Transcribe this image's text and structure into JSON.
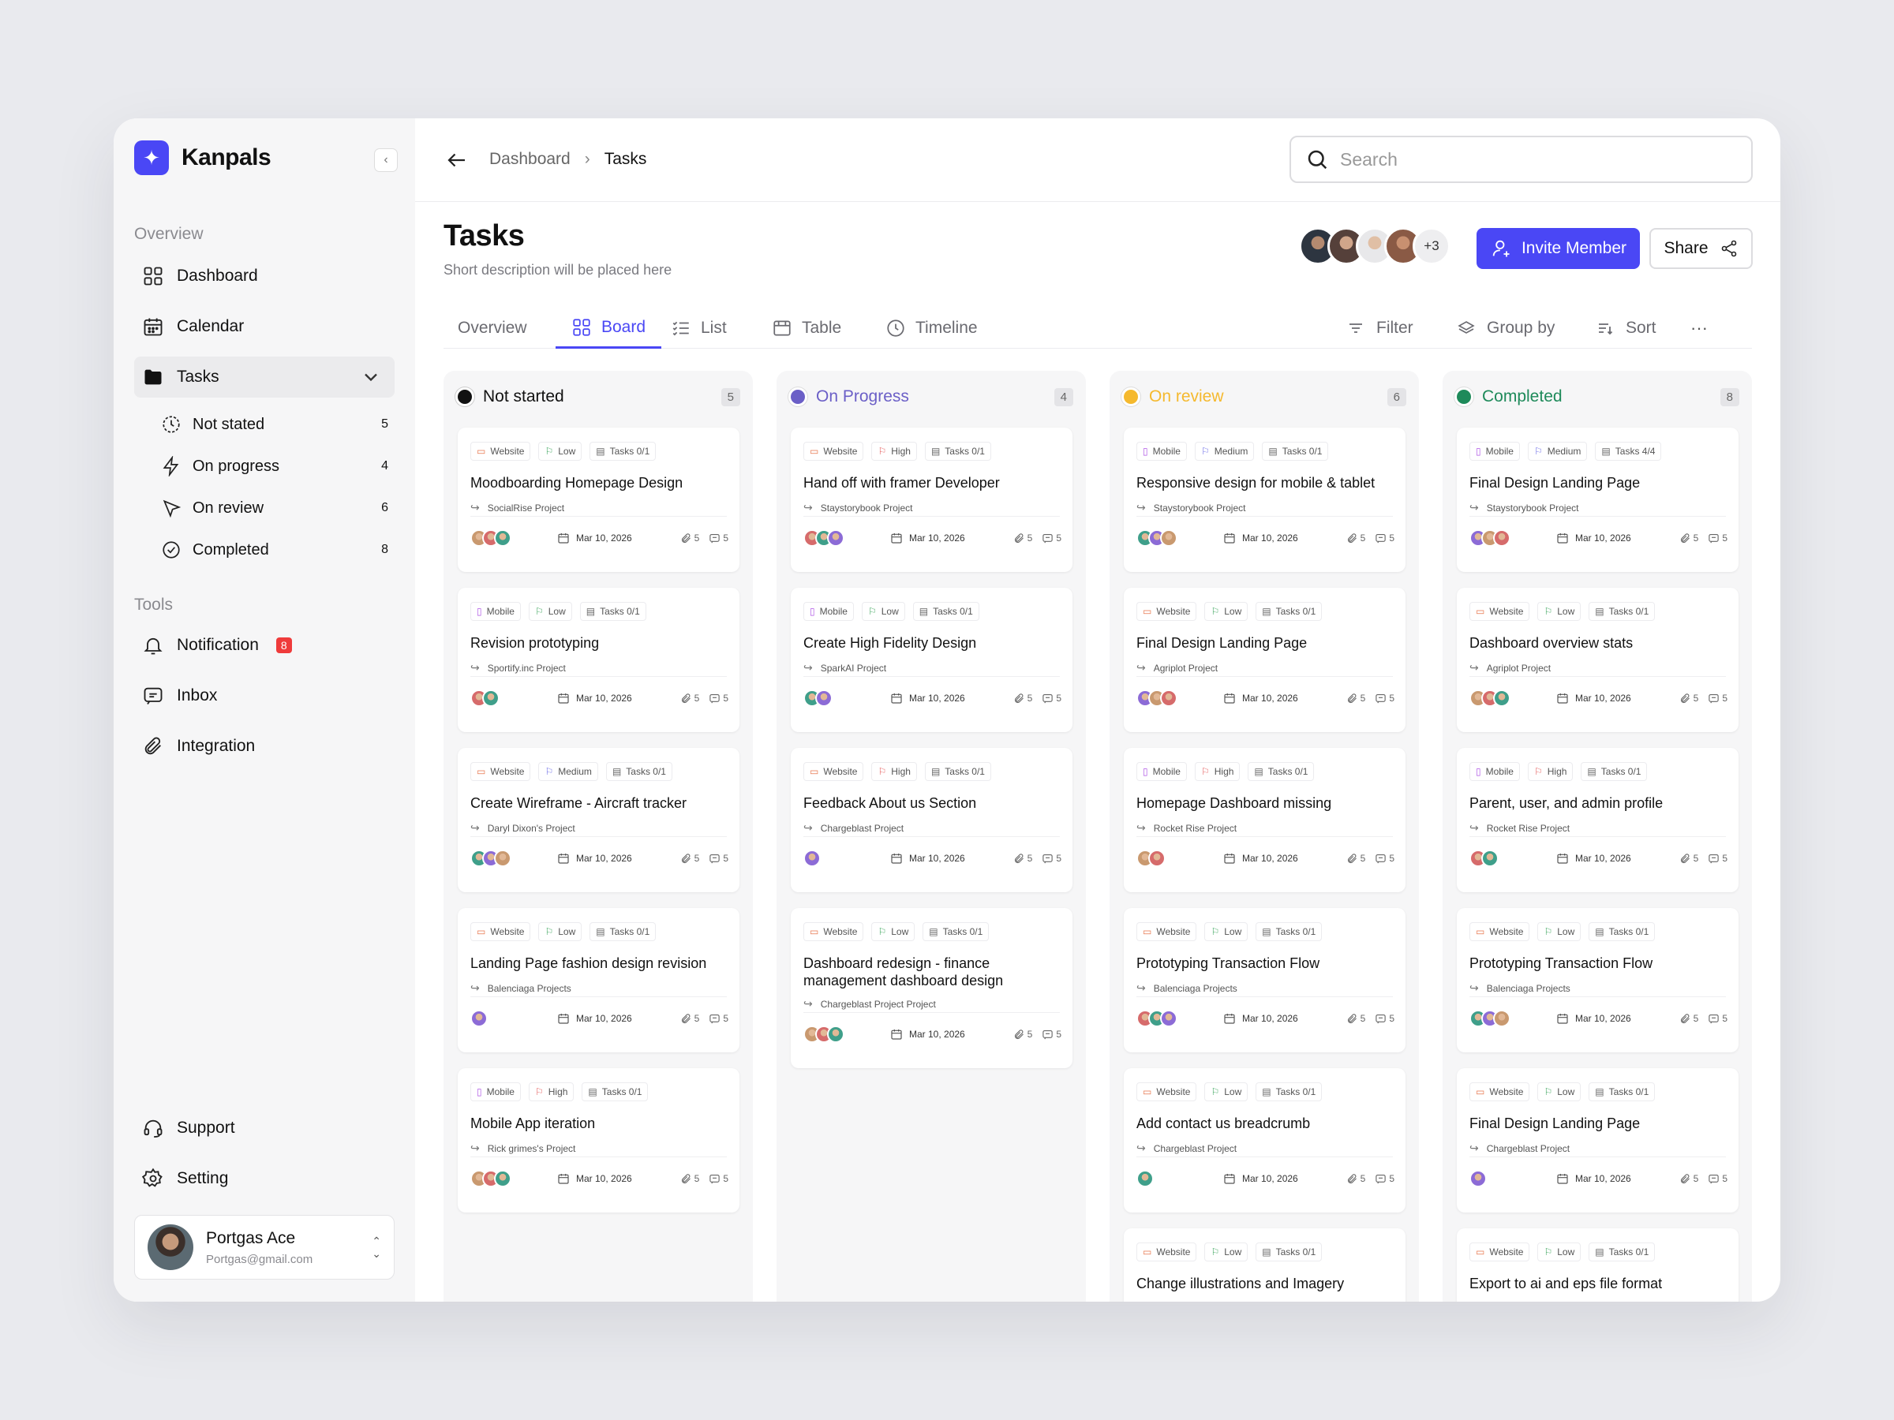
{
  "app": {
    "name": "Kanpals"
  },
  "sidebar": {
    "overview_label": "Overview",
    "tools_label": "Tools",
    "nav": {
      "dashboard": "Dashboard",
      "calendar": "Calendar",
      "tasks": "Tasks",
      "notification": "Notification",
      "notification_badge": "8",
      "inbox": "Inbox",
      "integration": "Integration",
      "support": "Support",
      "setting": "Setting"
    },
    "sub": [
      {
        "label": "Not stated",
        "count": "5"
      },
      {
        "label": "On progress",
        "count": "4"
      },
      {
        "label": "On review",
        "count": "6"
      },
      {
        "label": "Completed",
        "count": "8"
      }
    ],
    "profile": {
      "name": "Portgas Ace",
      "email": "Portgas@gmail.com"
    }
  },
  "topbar": {
    "crumb1": "Dashboard",
    "crumb2": "Tasks",
    "search_placeholder": "Search"
  },
  "header": {
    "title": "Tasks",
    "description": "Short description will be placed here",
    "more_members": "+3",
    "invite": "Invite Member",
    "share": "Share"
  },
  "tabs": [
    "Overview",
    "Board",
    "List",
    "Table",
    "Timeline"
  ],
  "tools": [
    "Filter",
    "Group by",
    "Sort"
  ],
  "colors": {
    "accent": "#4a47f5",
    "not_started": "#111111",
    "on_progress": "#6b5fc7",
    "on_review": "#f5b92e",
    "completed": "#1e8a5a"
  },
  "columns": [
    {
      "title": "Not started",
      "count": "5",
      "cards": [
        {
          "type": "Website",
          "priority": "Low",
          "tasks": "Tasks 0/1",
          "title": "Moodboarding Homepage Design",
          "project": "SocialRise Project",
          "members": 3,
          "date": "Mar 10, 2026",
          "attachments": "5",
          "comments": "5"
        },
        {
          "type": "Mobile",
          "priority": "Low",
          "tasks": "Tasks 0/1",
          "title": "Revision prototyping",
          "project": "Sportify.inc Project",
          "members": 2,
          "date": "Mar 10, 2026",
          "attachments": "5",
          "comments": "5"
        },
        {
          "type": "Website",
          "priority": "Medium",
          "tasks": "Tasks 0/1",
          "title": "Create Wireframe - Aircraft tracker",
          "project": "Daryl Dixon's Project",
          "members": 3,
          "date": "Mar 10, 2026",
          "attachments": "5",
          "comments": "5"
        },
        {
          "type": "Website",
          "priority": "Low",
          "tasks": "Tasks 0/1",
          "title": "Landing Page fashion design revision",
          "project": "Balenciaga Projects",
          "members": 1,
          "date": "Mar 10, 2026",
          "attachments": "5",
          "comments": "5"
        },
        {
          "type": "Mobile",
          "priority": "High",
          "tasks": "Tasks 0/1",
          "title": "Mobile App iteration",
          "project": "Rick grimes's Project",
          "members": 3,
          "date": "Mar 10, 2026",
          "attachments": "5",
          "comments": "5"
        }
      ]
    },
    {
      "title": "On Progress",
      "count": "4",
      "cards": [
        {
          "type": "Website",
          "priority": "High",
          "tasks": "Tasks 0/1",
          "title": "Hand off with framer Developer",
          "project": "Staystorybook Project",
          "members": 3,
          "date": "Mar 10, 2026",
          "attachments": "5",
          "comments": "5"
        },
        {
          "type": "Mobile",
          "priority": "Low",
          "tasks": "Tasks 0/1",
          "title": "Create High Fidelity Design",
          "project": "SparkAI Project",
          "members": 2,
          "date": "Mar 10, 2026",
          "attachments": "5",
          "comments": "5"
        },
        {
          "type": "Website",
          "priority": "High",
          "tasks": "Tasks 0/1",
          "title": "Feedback About us Section",
          "project": "Chargeblast  Project",
          "members": 1,
          "date": "Mar 10, 2026",
          "attachments": "5",
          "comments": "5"
        },
        {
          "type": "Website",
          "priority": "Low",
          "tasks": "Tasks 0/1",
          "title": "Dashboard redesign - finance management dashboard design",
          "project": "Chargeblast Project Project",
          "members": 3,
          "date": "Mar 10, 2026",
          "attachments": "5",
          "comments": "5"
        }
      ]
    },
    {
      "title": "On review",
      "count": "6",
      "cards": [
        {
          "type": "Mobile",
          "priority": "Medium",
          "tasks": "Tasks 0/1",
          "title": "Responsive design for mobile & tablet",
          "project": "Staystorybook Project",
          "members": 3,
          "date": "Mar 10, 2026",
          "attachments": "5",
          "comments": "5"
        },
        {
          "type": "Website",
          "priority": "Low",
          "tasks": "Tasks 0/1",
          "title": "Final Design Landing Page",
          "project": "Agriplot Project",
          "members": 3,
          "date": "Mar 10, 2026",
          "attachments": "5",
          "comments": "5"
        },
        {
          "type": "Mobile",
          "priority": "High",
          "tasks": "Tasks 0/1",
          "title": "Homepage Dashboard missing",
          "project": "Rocket Rise Project",
          "members": 2,
          "date": "Mar 10, 2026",
          "attachments": "5",
          "comments": "5"
        },
        {
          "type": "Website",
          "priority": "Low",
          "tasks": "Tasks 0/1",
          "title": "Prototyping Transaction Flow",
          "project": "Balenciaga Projects",
          "members": 3,
          "date": "Mar 10, 2026",
          "attachments": "5",
          "comments": "5"
        },
        {
          "type": "Website",
          "priority": "Low",
          "tasks": "Tasks 0/1",
          "title": "Add contact us breadcrumb",
          "project": "Chargeblast  Project",
          "members": 1,
          "date": "Mar 10, 2026",
          "attachments": "5",
          "comments": "5"
        },
        {
          "type": "Website",
          "priority": "Low",
          "tasks": "Tasks 0/1",
          "title": "Change illustrations and Imagery",
          "project": "",
          "members": 0,
          "date": "",
          "attachments": "",
          "comments": ""
        }
      ]
    },
    {
      "title": "Completed",
      "count": "8",
      "cards": [
        {
          "type": "Mobile",
          "priority": "Medium",
          "tasks": "Tasks 4/4",
          "title": "Final Design Landing Page",
          "project": "Staystorybook Project",
          "members": 3,
          "date": "Mar 10, 2026",
          "attachments": "5",
          "comments": "5"
        },
        {
          "type": "Website",
          "priority": "Low",
          "tasks": "Tasks 0/1",
          "title": "Dashboard overview stats",
          "project": "Agriplot Project",
          "members": 3,
          "date": "Mar 10, 2026",
          "attachments": "5",
          "comments": "5"
        },
        {
          "type": "Mobile",
          "priority": "High",
          "tasks": "Tasks 0/1",
          "title": "Parent, user, and admin profile",
          "project": "Rocket Rise Project",
          "members": 2,
          "date": "Mar 10, 2026",
          "attachments": "5",
          "comments": "5"
        },
        {
          "type": "Website",
          "priority": "Low",
          "tasks": "Tasks 0/1",
          "title": "Prototyping Transaction Flow",
          "project": "Balenciaga Projects",
          "members": 3,
          "date": "Mar 10, 2026",
          "attachments": "5",
          "comments": "5"
        },
        {
          "type": "Website",
          "priority": "Low",
          "tasks": "Tasks 0/1",
          "title": "Final Design Landing Page",
          "project": "Chargeblast  Project",
          "members": 1,
          "date": "Mar 10, 2026",
          "attachments": "5",
          "comments": "5"
        },
        {
          "type": "Website",
          "priority": "Low",
          "tasks": "Tasks 0/1",
          "title": "Export to ai and eps file format",
          "project": "",
          "members": 0,
          "date": "",
          "attachments": "",
          "comments": ""
        }
      ]
    }
  ]
}
